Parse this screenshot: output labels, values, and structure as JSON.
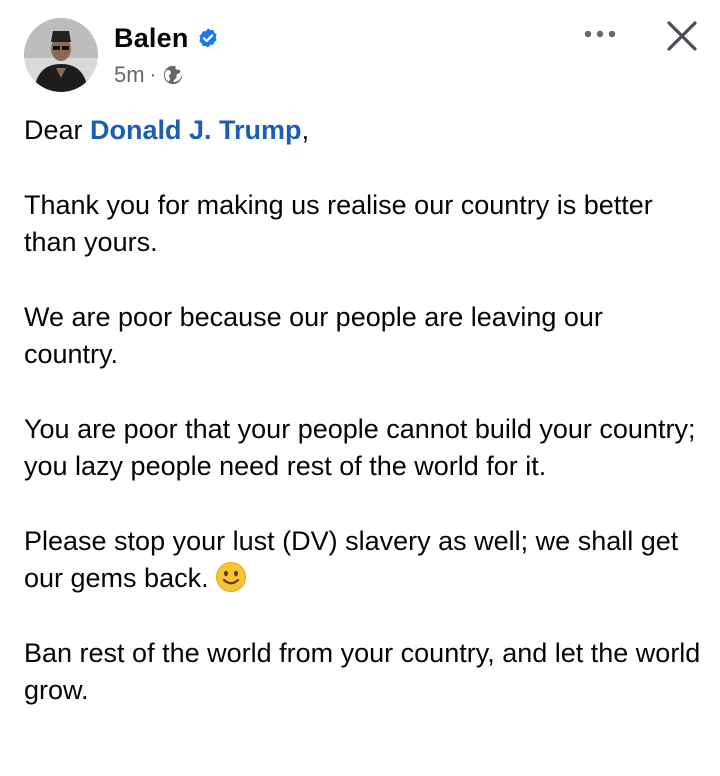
{
  "post": {
    "author": "Balen",
    "time": "5m",
    "separator": "·",
    "icons": {
      "verified": "verified-badge-icon",
      "audience": "globe-icon",
      "more": "more-dots-icon",
      "close": "close-icon",
      "emoji": "smiling-face-emoji"
    },
    "colors": {
      "mention": "#1b5fb4",
      "verified": "#1877f2",
      "meta": "#65676b"
    },
    "greeting_prefix": "Dear ",
    "mention": "Donald J. Trump",
    "greeting_suffix": ",",
    "paragraphs": [
      "Thank you for making us realise our country is better than yours.",
      "We are poor because our people are leaving our country.",
      "You are poor that your people cannot build your country; you lazy people need rest of the world for it.",
      "Please stop your lust (DV) slavery as well; we shall get our gems back.",
      "Ban rest of the world from your country, and let the world grow."
    ]
  }
}
